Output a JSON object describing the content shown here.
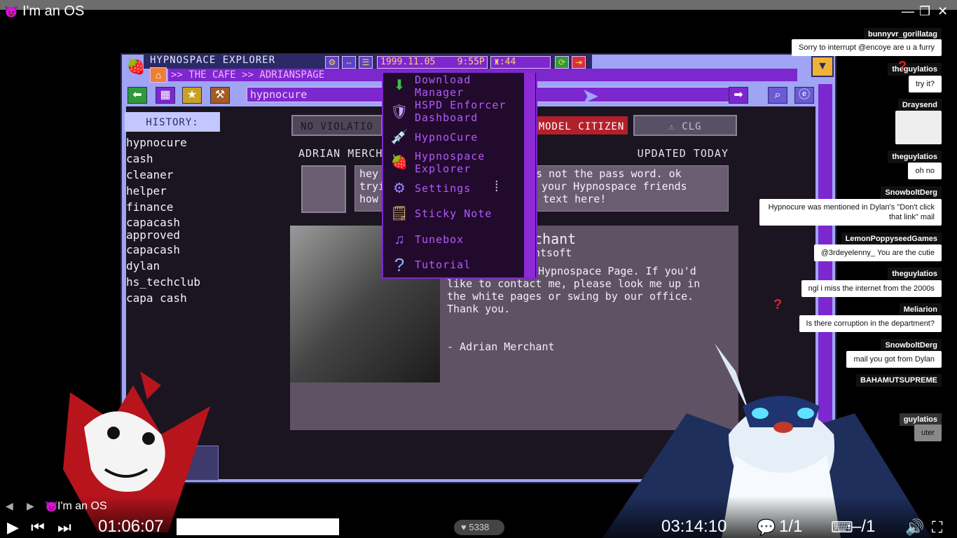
{
  "window": {
    "title": "I'm an OS",
    "minimize_icon": "minimize-icon",
    "restore_icon": "restore-icon",
    "close_icon": "close-icon"
  },
  "app": {
    "title": "HYPNOSPACE EXPLORER",
    "date": "1999.11.05",
    "time": "9:55P",
    "counter": "44",
    "breadcrumb": ">> THE CAFE >> ADRIANSPAGE",
    "search_value": "hypnocure"
  },
  "history": {
    "heading": "HISTORY:",
    "items": [
      "hypnocure",
      "cash",
      "cleaner",
      "helper",
      "finance",
      "capacash",
      "approved",
      "capacash",
      "dylan",
      "hs_techclub",
      "capa cash"
    ]
  },
  "page": {
    "status_left": "NO VIOLATIO",
    "status_mid": "MODEL CITIZEN",
    "status_right": "CLG",
    "author_label": "ADRIAN MERCH",
    "updated": "UPDATED TODAY",
    "msg_line1": "hey",
    "msg_line1b": "s not the pass word. ok",
    "msg_line2": "tryi",
    "msg_line2b": "your Hypnospace friends",
    "msg_line3": "how",
    "msg_line3b": "text here!",
    "bio_name": "chant",
    "bio_company": "ntsoft",
    "bio_p1": "Hypnospace Page. If you'd",
    "bio_p2": "like to contact me, please look me up in",
    "bio_p3": "the white pages or swing by our office.",
    "bio_p4": "Thank you.",
    "signature": "- Adrian Merchant"
  },
  "menu": {
    "items": [
      {
        "label1": "Download",
        "label2": "Manager",
        "icon": "download-icon"
      },
      {
        "label1": "HSPD Enforcer",
        "label2": "Dashboard",
        "icon": "badge-icon"
      },
      {
        "label1": "HypnoCure",
        "label2": "",
        "icon": "syringe-icon"
      },
      {
        "label1": "Hypnospace",
        "label2": "Explorer",
        "icon": "explorer-icon"
      },
      {
        "label1": "Settings",
        "label2": "",
        "icon": "gear-icon"
      },
      {
        "label1": "Sticky Note",
        "label2": "",
        "icon": "sticky-note-icon"
      },
      {
        "label1": "Tunebox",
        "label2": "",
        "icon": "music-note-icon"
      },
      {
        "label1": "Tutorial",
        "label2": "",
        "icon": "question-icon"
      }
    ]
  },
  "chat": [
    {
      "name": "bunnyvr_gorillatag",
      "msg": "Sorry to interrupt @encoye are u a furry"
    },
    {
      "name": "theguylatios",
      "msg": "try it?"
    },
    {
      "name": "Draysend",
      "msg": ""
    },
    {
      "name": "theguylatios",
      "msg": "oh no"
    },
    {
      "name": "SnowboltDerg",
      "msg": "Hypnocure was mentioned in Dylan's \"Don't click that link\" mail"
    },
    {
      "name": "LemonPoppyseedGames",
      "msg": "@3rdeyelenny_ You are the cutie"
    },
    {
      "name": "theguylatios",
      "msg": "ngl i miss the internet from the 2000s"
    },
    {
      "name": "Meliarion",
      "msg": "Is there corruption in the department?"
    },
    {
      "name": "SnowboltDerg",
      "msg": "mail you got from Dylan"
    },
    {
      "name": "BAHAMUTSUPREME",
      "msg": ""
    },
    {
      "name": "guylatios",
      "msg": "uter"
    }
  ],
  "player": {
    "channel": "I'm an OS",
    "elapsed": "01:06:07",
    "duration": "03:14:10",
    "likes": "5338",
    "chat_count": "1/1",
    "caption_count": "–/1",
    "progress": 0.34
  }
}
